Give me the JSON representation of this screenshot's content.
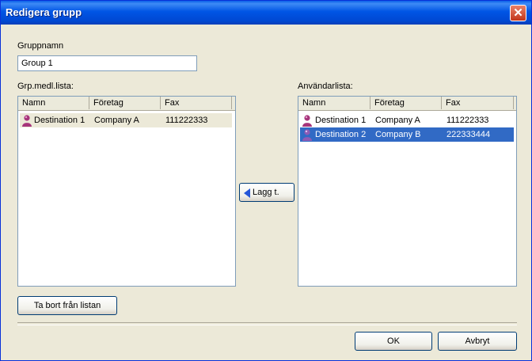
{
  "window": {
    "title": "Redigera grupp",
    "close_glyph": "✕"
  },
  "group_name": {
    "label": "Gruppnamn",
    "value": "Group 1"
  },
  "member_list": {
    "label": "Grp.medl.lista:",
    "columns": [
      "Namn",
      "Företag",
      "Fax"
    ],
    "rows": [
      {
        "name": "Destination 1",
        "company": "Company A",
        "fax": "111222333",
        "icon": "user-icon"
      }
    ]
  },
  "user_list": {
    "label": "Användarlista:",
    "columns": [
      "Namn",
      "Företag",
      "Fax"
    ],
    "rows": [
      {
        "name": "Destination 1",
        "company": "Company A",
        "fax": "111222333",
        "icon": "user-icon"
      },
      {
        "name": "Destination 2",
        "company": "Company B",
        "fax": "222333444",
        "icon": "user-icon"
      }
    ]
  },
  "buttons": {
    "add": "Lagg t.",
    "remove": "Ta bort från listan",
    "ok": "OK",
    "cancel": "Avbryt"
  },
  "colors": {
    "title_bar": "#0055E5",
    "selection": "#316AC5",
    "dialog_bg": "#ECE9D8"
  }
}
